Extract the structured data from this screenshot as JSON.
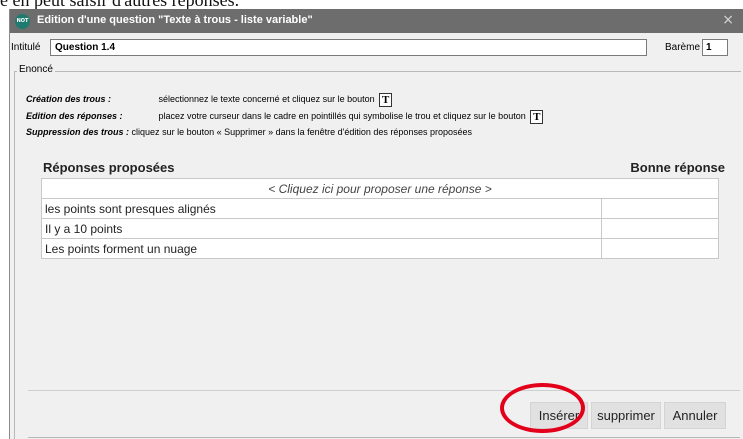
{
  "caption_top": "e en peut saisir d'autres réponses.",
  "window": {
    "icon_text": "NOT",
    "title": "Edition d'une question \"Texte à trous - liste variable\"",
    "close_glyph": "×"
  },
  "intitule": {
    "label": "Intitulé",
    "value": "Question 1.4"
  },
  "bareme": {
    "label": "Barème",
    "value": "1"
  },
  "enonce": {
    "legend": "Enoncé",
    "instructions": [
      {
        "label": "Création des trous :",
        "text": "sélectionnez le texte concerné et cliquez sur le bouton",
        "icon": "T"
      },
      {
        "label": "Edition des réponses :",
        "text": "placez votre curseur dans le cadre en pointillés qui symbolise le trou et cliquez sur le bouton",
        "icon": "T"
      },
      {
        "label": "Suppression des trous :",
        "text": "cliquez sur le bouton « Supprimer » dans la fenêtre d'édition des réponses proposées",
        "icon": ""
      }
    ]
  },
  "answers": {
    "header_left": "Réponses proposées",
    "header_right": "Bonne réponse",
    "prompt": "< Cliquez ici pour proposer une réponse >",
    "rows": [
      {
        "text": "les points sont presques alignés",
        "correct": ""
      },
      {
        "text": "Il y a 10 points",
        "correct": ""
      },
      {
        "text": "Les points forment un nuage",
        "correct": ""
      }
    ]
  },
  "buttons": {
    "insert": "Insérer",
    "delete": "supprimer",
    "cancel": "Annuler"
  },
  "colors": {
    "titlebar": "#6d6d6d",
    "highlight_circle": "#e3001b"
  }
}
